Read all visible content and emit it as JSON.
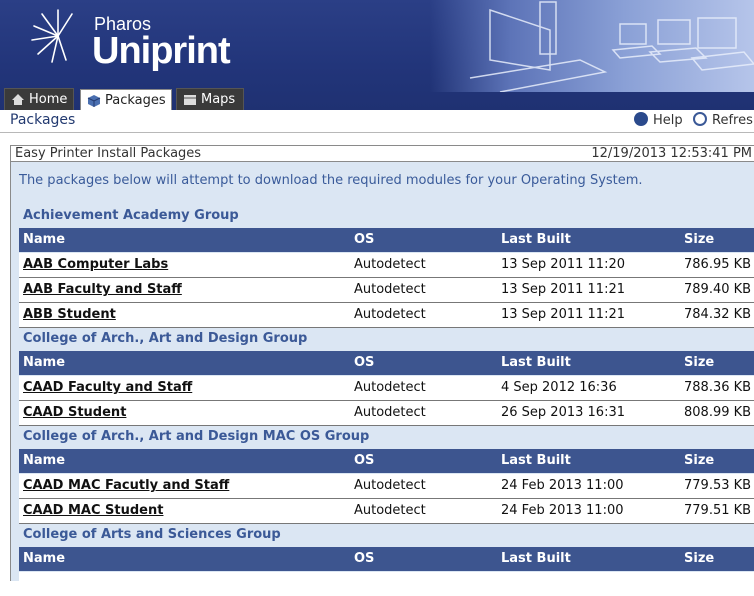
{
  "branding": {
    "vendor": "Pharos",
    "product": "Uniprint"
  },
  "tabs": [
    {
      "label": "Home",
      "icon": "home-icon",
      "active": false
    },
    {
      "label": "Packages",
      "icon": "package-icon",
      "active": true
    },
    {
      "label": "Maps",
      "icon": "map-icon",
      "active": false
    }
  ],
  "page_title": "Packages",
  "toolbar": {
    "help_label": "Help",
    "refresh_label": "Refres"
  },
  "panel": {
    "title": "Easy Printer Install Packages",
    "timestamp": "12/19/2013 12:53:41 PM",
    "intro": "The packages below will attempt to download the required modules for your Operating System."
  },
  "columns": {
    "name": "Name",
    "os": "OS",
    "built": "Last Built",
    "size": "Size"
  },
  "groups": [
    {
      "title": "Achievement Academy Group",
      "rows": [
        {
          "name": "AAB Computer Labs",
          "os": "Autodetect",
          "built": "13 Sep 2011 11:20",
          "size": "786.95 KB"
        },
        {
          "name": "AAB Faculty and Staff",
          "os": "Autodetect",
          "built": "13 Sep 2011 11:21",
          "size": "789.40 KB"
        },
        {
          "name": "ABB Student",
          "os": "Autodetect",
          "built": "13 Sep 2011 11:21",
          "size": "784.32 KB"
        }
      ]
    },
    {
      "title": "College of Arch., Art and Design Group",
      "rows": [
        {
          "name": "CAAD Faculty and Staff",
          "os": "Autodetect",
          "built": "4 Sep 2012 16:36",
          "size": "788.36 KB"
        },
        {
          "name": "CAAD Student",
          "os": "Autodetect",
          "built": "26 Sep 2013 16:31",
          "size": "808.99 KB"
        }
      ]
    },
    {
      "title": "College of Arch., Art and Design MAC OS Group",
      "rows": [
        {
          "name": "CAAD MAC Facutly and Staff",
          "os": "Autodetect",
          "built": "24 Feb 2013 11:00",
          "size": "779.53 KB"
        },
        {
          "name": "CAAD MAC Student",
          "os": "Autodetect",
          "built": "24 Feb 2013 11:00",
          "size": "779.51 KB"
        }
      ]
    },
    {
      "title": "College of Arts and Sciences Group",
      "rows": []
    }
  ],
  "colors": {
    "banner": "#22357a",
    "header_row": "#3d558f",
    "group_text": "#3b5997",
    "panel_bg": "#dbe6f3"
  }
}
